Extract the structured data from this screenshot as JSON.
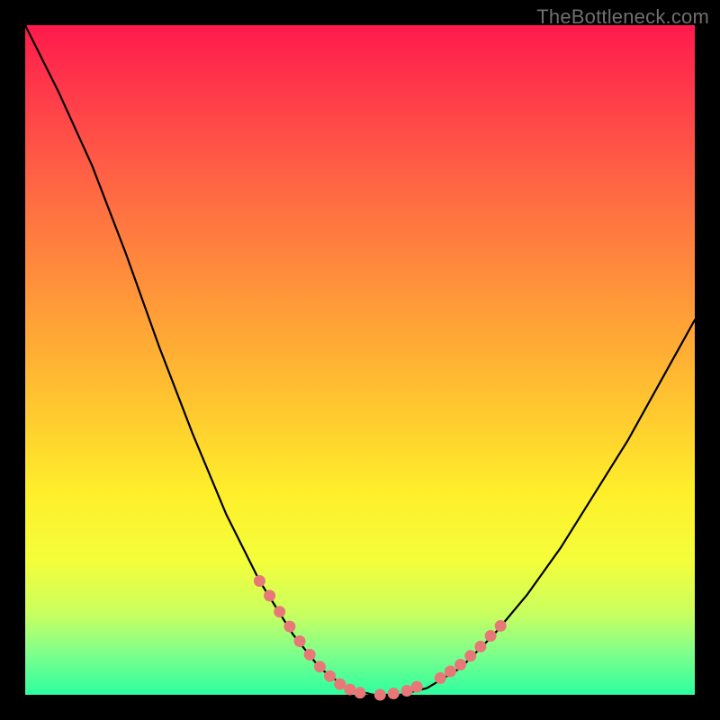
{
  "watermark": "TheBottleneck.com",
  "colors": {
    "frame": "#000000",
    "curve": "#000000",
    "marker_fill": "#e87878",
    "marker_stroke": "#a04848"
  },
  "chart_data": {
    "type": "line",
    "title": "",
    "xlabel": "",
    "ylabel": "",
    "xlim": [
      0,
      100
    ],
    "ylim": [
      0,
      100
    ],
    "grid": false,
    "legend": false,
    "series": [
      {
        "name": "bottleneck-curve",
        "x": [
          0,
          5,
          10,
          15,
          20,
          25,
          30,
          35,
          40,
          44,
          48,
          52,
          56,
          60,
          65,
          70,
          75,
          80,
          85,
          90,
          95,
          100
        ],
        "y": [
          100,
          90,
          79,
          66,
          52,
          39,
          27,
          17,
          9,
          4,
          1,
          0,
          0,
          1,
          4,
          9,
          15,
          22,
          30,
          38,
          47,
          56
        ]
      }
    ],
    "markers": {
      "comment": "salmon dotted segments near the valley",
      "left_branch": [
        {
          "x": 35.0,
          "y": 17.0
        },
        {
          "x": 36.5,
          "y": 14.8
        },
        {
          "x": 38.0,
          "y": 12.4
        },
        {
          "x": 39.5,
          "y": 10.2
        },
        {
          "x": 41.0,
          "y": 8.0
        },
        {
          "x": 42.5,
          "y": 6.0
        },
        {
          "x": 44.0,
          "y": 4.2
        },
        {
          "x": 45.5,
          "y": 2.8
        },
        {
          "x": 47.0,
          "y": 1.6
        },
        {
          "x": 48.5,
          "y": 0.8
        },
        {
          "x": 50.0,
          "y": 0.3
        },
        {
          "x": 53.0,
          "y": 0.0
        },
        {
          "x": 55.0,
          "y": 0.2
        },
        {
          "x": 57.0,
          "y": 0.6
        },
        {
          "x": 58.5,
          "y": 1.2
        }
      ],
      "right_branch": [
        {
          "x": 62.0,
          "y": 2.5
        },
        {
          "x": 63.5,
          "y": 3.5
        },
        {
          "x": 65.0,
          "y": 4.5
        },
        {
          "x": 66.5,
          "y": 5.8
        },
        {
          "x": 68.0,
          "y": 7.2
        },
        {
          "x": 69.5,
          "y": 8.8
        },
        {
          "x": 71.0,
          "y": 10.3
        }
      ]
    }
  }
}
